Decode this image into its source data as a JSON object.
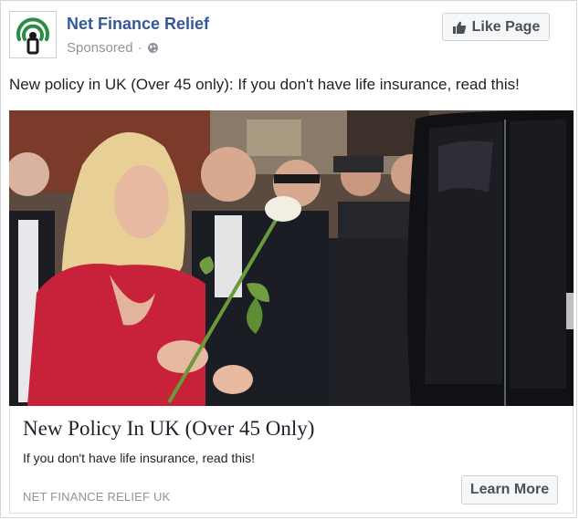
{
  "ad": {
    "page_name": "Net Finance Relief",
    "sponsored_label": "Sponsored",
    "separator": "·",
    "like_button_label": "Like Page",
    "post_text": "New policy in UK (Over 45 only): If you don't have life insurance, read this!",
    "image": {
      "icon": "photo",
      "description_hidden": true
    },
    "link": {
      "headline": "New Policy In UK (Over 45 Only)",
      "description": "If you don't have life insurance, read this!",
      "domain": "NET FINANCE RELIEF UK",
      "cta_label": "Learn More"
    }
  },
  "colors": {
    "page_name": "#365899",
    "logo_green": "#2e8b45",
    "muted_text": "#90949c",
    "button_text": "#4b4f56",
    "dress_red": "#c8223a"
  }
}
